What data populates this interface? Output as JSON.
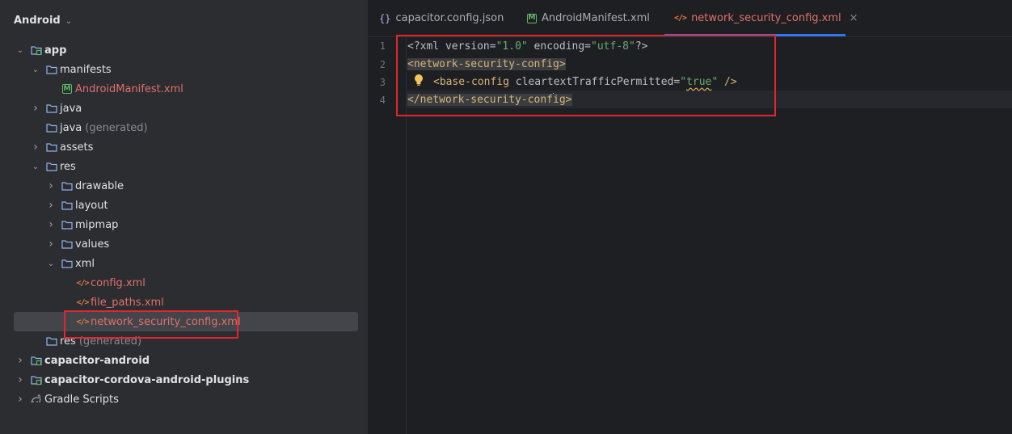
{
  "sidebar": {
    "title": "Android",
    "tree": [
      {
        "label": "app",
        "suffix": "",
        "style": "bold",
        "arrow": "open",
        "icon": "module-folder-icon"
      },
      {
        "label": "manifests",
        "suffix": "",
        "style": "",
        "arrow": "open",
        "icon": "folder-icon"
      },
      {
        "label": "AndroidManifest.xml",
        "suffix": "",
        "style": "red",
        "arrow": "",
        "icon": "manifest-icon"
      },
      {
        "label": "java",
        "suffix": "",
        "style": "",
        "arrow": "closed",
        "icon": "folder-icon"
      },
      {
        "label": "java",
        "suffix": "(generated)",
        "style": "",
        "arrow": "",
        "icon": "folder-icon"
      },
      {
        "label": "assets",
        "suffix": "",
        "style": "",
        "arrow": "closed",
        "icon": "folder-icon"
      },
      {
        "label": "res",
        "suffix": "",
        "style": "",
        "arrow": "open",
        "icon": "folder-icon"
      },
      {
        "label": "drawable",
        "suffix": "",
        "style": "",
        "arrow": "closed",
        "icon": "folder-icon"
      },
      {
        "label": "layout",
        "suffix": "",
        "style": "",
        "arrow": "closed",
        "icon": "folder-icon"
      },
      {
        "label": "mipmap",
        "suffix": "",
        "style": "",
        "arrow": "closed",
        "icon": "folder-icon"
      },
      {
        "label": "values",
        "suffix": "",
        "style": "",
        "arrow": "closed",
        "icon": "folder-icon"
      },
      {
        "label": "xml",
        "suffix": "",
        "style": "",
        "arrow": "open",
        "icon": "folder-icon"
      },
      {
        "label": "config.xml",
        "suffix": "",
        "style": "red",
        "arrow": "",
        "icon": "xml-file-icon"
      },
      {
        "label": "file_paths.xml",
        "suffix": "",
        "style": "red",
        "arrow": "",
        "icon": "xml-file-icon"
      },
      {
        "label": "network_security_config.xml",
        "suffix": "",
        "style": "red",
        "arrow": "",
        "icon": "xml-file-icon"
      },
      {
        "label": "res",
        "suffix": "(generated)",
        "style": "",
        "arrow": "",
        "icon": "folder-icon"
      },
      {
        "label": "capacitor-android",
        "suffix": "",
        "style": "bold",
        "arrow": "closed",
        "icon": "module-folder-icon"
      },
      {
        "label": "capacitor-cordova-android-plugins",
        "suffix": "",
        "style": "bold",
        "arrow": "closed",
        "icon": "module-folder-icon"
      },
      {
        "label": "Gradle Scripts",
        "suffix": "",
        "style": "",
        "arrow": "closed",
        "icon": "gradle-icon"
      }
    ]
  },
  "tabs": [
    {
      "label": "capacitor.config.json",
      "icon": "json-icon"
    },
    {
      "label": "AndroidManifest.xml",
      "icon": "manifest-icon"
    },
    {
      "label": "network_security_config.xml",
      "icon": "xml-file-icon",
      "close": "×"
    }
  ],
  "editor": {
    "line_numbers": [
      "1",
      "2",
      "3",
      "4"
    ],
    "line1": {
      "pi_open": "<?xml ",
      "a1": "version=",
      "v1": "\"1.0\"",
      "a2": " encoding=",
      "v2": "\"utf-8\"",
      "pi_close": "?>"
    },
    "line2": {
      "tag": "<network-security-config>"
    },
    "line3": {
      "tag_open": "<base-config ",
      "attr": "cleartextTrafficPermitted=",
      "quote_open": "\"",
      "value": "true",
      "quote_close": "\"",
      "tag_close": " />"
    },
    "line4": {
      "before_caret": "</network-security-conf",
      "after_caret": "ig>"
    }
  },
  "colors": {
    "accent": "#3574f0",
    "annotation_box": "#e0272d",
    "xml_tag": "#d5b778",
    "xml_value": "#6aab73",
    "modified_file": "#e0706b"
  }
}
